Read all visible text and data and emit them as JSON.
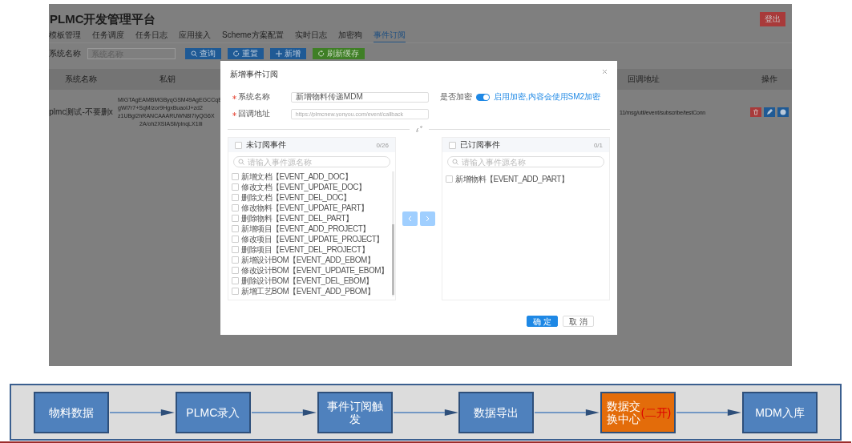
{
  "app": {
    "title": "PLMC开发管理平台",
    "logout": "登出",
    "tabs": [
      {
        "label": "模板管理",
        "selected": false
      },
      {
        "label": "任务调度",
        "selected": false
      },
      {
        "label": "任务日志",
        "selected": false
      },
      {
        "label": "应用接入",
        "selected": false
      },
      {
        "label": "Scheme方案配置",
        "selected": false
      },
      {
        "label": "实时日志",
        "selected": false
      },
      {
        "label": "加密狗",
        "selected": false
      },
      {
        "label": "事件订阅",
        "selected": true
      }
    ],
    "filter": {
      "label": "系统名称",
      "placeholder": "系统名称"
    },
    "buttons": [
      {
        "label": "查询",
        "kind": "search"
      },
      {
        "label": "重置",
        "kind": "reset"
      },
      {
        "label": "新增",
        "kind": "add"
      },
      {
        "label": "刷新缓存",
        "kind": "refresh"
      }
    ],
    "table": {
      "columns": [
        "系统名称",
        "私钥",
        "回调地址",
        "操作"
      ],
      "rows": [
        {
          "system": "plmc测试-不要删x",
          "key_lines": [
            "MIGTAgEAMBMGByqGSM49AgEGCCqB",
            "gWi7r7+SqM/zor9HgxBuaoIJ+zd2",
            "z1UBgi2hRANCAAARUWN8I7IyQG6X",
            "2A/oh2XSIASli/plnqLX1Ili"
          ],
          "callback": "11/msg/util/event/subscribe/testConn",
          "actions": [
            {
              "kind": "delete"
            },
            {
              "kind": "edit"
            },
            {
              "kind": "info"
            }
          ]
        }
      ]
    }
  },
  "dialog": {
    "title": "新增事件订阅",
    "fields": [
      {
        "label": "系统名称",
        "required": true,
        "value": "新增物料传递MDM"
      },
      {
        "label": "回调地址",
        "required": true,
        "placeholder": "https://plmcnew.yonyou.com/event/callback"
      }
    ],
    "encrypt": {
      "label": "是否加密",
      "on": true,
      "hint": "启用加密,内容会使用SM2加密"
    },
    "transfer": {
      "source": {
        "title": "未订阅事件",
        "checked": false,
        "count": "0/26",
        "placeholder": "请输入事件源名称",
        "items": [
          {
            "label": "新增文档【EVENT_ADD_DOC】",
            "checked": false
          },
          {
            "label": "修改文档【EVENT_UPDATE_DOC】",
            "checked": false
          },
          {
            "label": "删除文档【EVENT_DEL_DOC】",
            "checked": false
          },
          {
            "label": "修改物料【EVENT_UPDATE_PART】",
            "checked": false
          },
          {
            "label": "删除物料【EVENT_DEL_PART】",
            "checked": false
          },
          {
            "label": "新增项目【EVENT_ADD_PROJECT】",
            "checked": false
          },
          {
            "label": "修改项目【EVENT_UPDATE_PROJECT】",
            "checked": false
          },
          {
            "label": "删除项目【EVENT_DEL_PROJECT】",
            "checked": false
          },
          {
            "label": "新增设计BOM【EVENT_ADD_EBOM】",
            "checked": false
          },
          {
            "label": "修改设计BOM【EVENT_UPDATE_EBOM】",
            "checked": false
          },
          {
            "label": "删除设计BOM【EVENT_DEL_EBOM】",
            "checked": false
          },
          {
            "label": "新增工艺BOM【EVENT_ADD_PBOM】",
            "checked": false
          }
        ]
      },
      "target": {
        "title": "已订阅事件",
        "checked": false,
        "count": "0/1",
        "placeholder": "请输入事件源名称",
        "items": [
          {
            "label": "新增物料【EVENT_ADD_PART】",
            "checked": false
          }
        ]
      },
      "moves": [
        {
          "kind": "left",
          "disabled": true
        },
        {
          "kind": "right",
          "disabled": true
        }
      ]
    },
    "buttons": [
      {
        "label": "确 定",
        "kind": "primary"
      },
      {
        "label": "取 消",
        "kind": "default"
      }
    ]
  },
  "flow": {
    "steps": [
      {
        "label": "物料数据",
        "kind": "normal"
      },
      {
        "label": "PLMC录入",
        "kind": "normal"
      },
      {
        "label": "事件订阅触发",
        "kind": "normal"
      },
      {
        "label": "数据导出",
        "kind": "normal"
      },
      {
        "label": "数据交换中心",
        "note": "(二开)",
        "kind": "highlight"
      },
      {
        "label": "MDM入库",
        "kind": "normal"
      }
    ]
  }
}
